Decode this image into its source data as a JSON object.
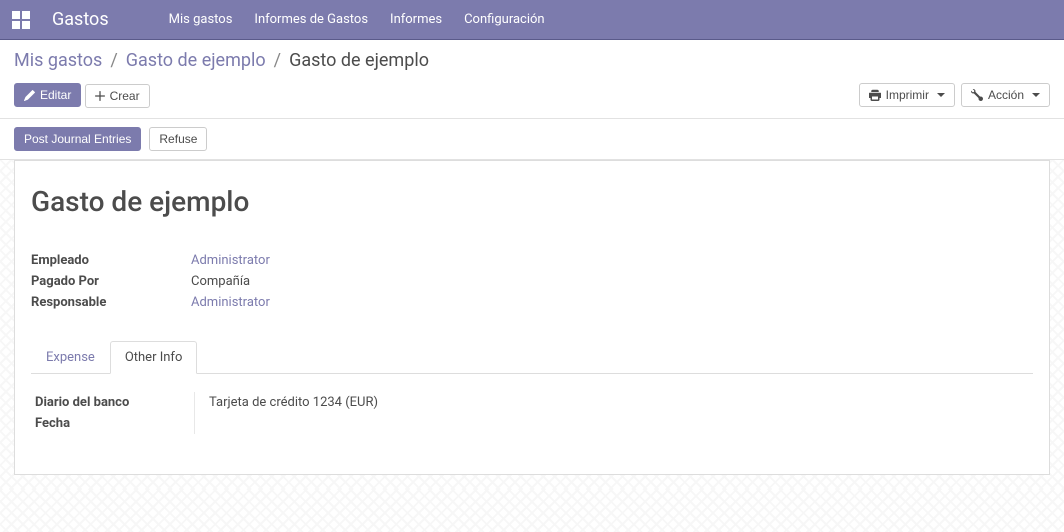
{
  "navbar": {
    "brand": "Gastos",
    "menu": [
      {
        "label": "Mis gastos"
      },
      {
        "label": "Informes de Gastos"
      },
      {
        "label": "Informes"
      },
      {
        "label": "Configuración"
      }
    ]
  },
  "breadcrumb": {
    "items": [
      {
        "label": "Mis gastos",
        "link": true
      },
      {
        "label": "Gasto de ejemplo",
        "link": true
      },
      {
        "label": "Gasto de ejemplo",
        "link": false
      }
    ]
  },
  "buttons": {
    "edit": "Editar",
    "create": "Crear",
    "print": "Imprimir",
    "action": "Acción"
  },
  "statusbar": {
    "post": "Post Journal Entries",
    "refuse": "Refuse"
  },
  "record": {
    "title": "Gasto de ejemplo",
    "fields": {
      "employee_label": "Empleado",
      "employee_value": "Administrator",
      "paidby_label": "Pagado Por",
      "paidby_value": "Compañía",
      "responsible_label": "Responsable",
      "responsible_value": "Administrator"
    },
    "tabs": {
      "expense": "Expense",
      "other": "Other Info"
    },
    "other_info": {
      "bank_journal_label": "Diario del banco",
      "bank_journal_value": "Tarjeta de crédito 1234 (EUR)",
      "date_label": "Fecha",
      "date_value": ""
    }
  }
}
